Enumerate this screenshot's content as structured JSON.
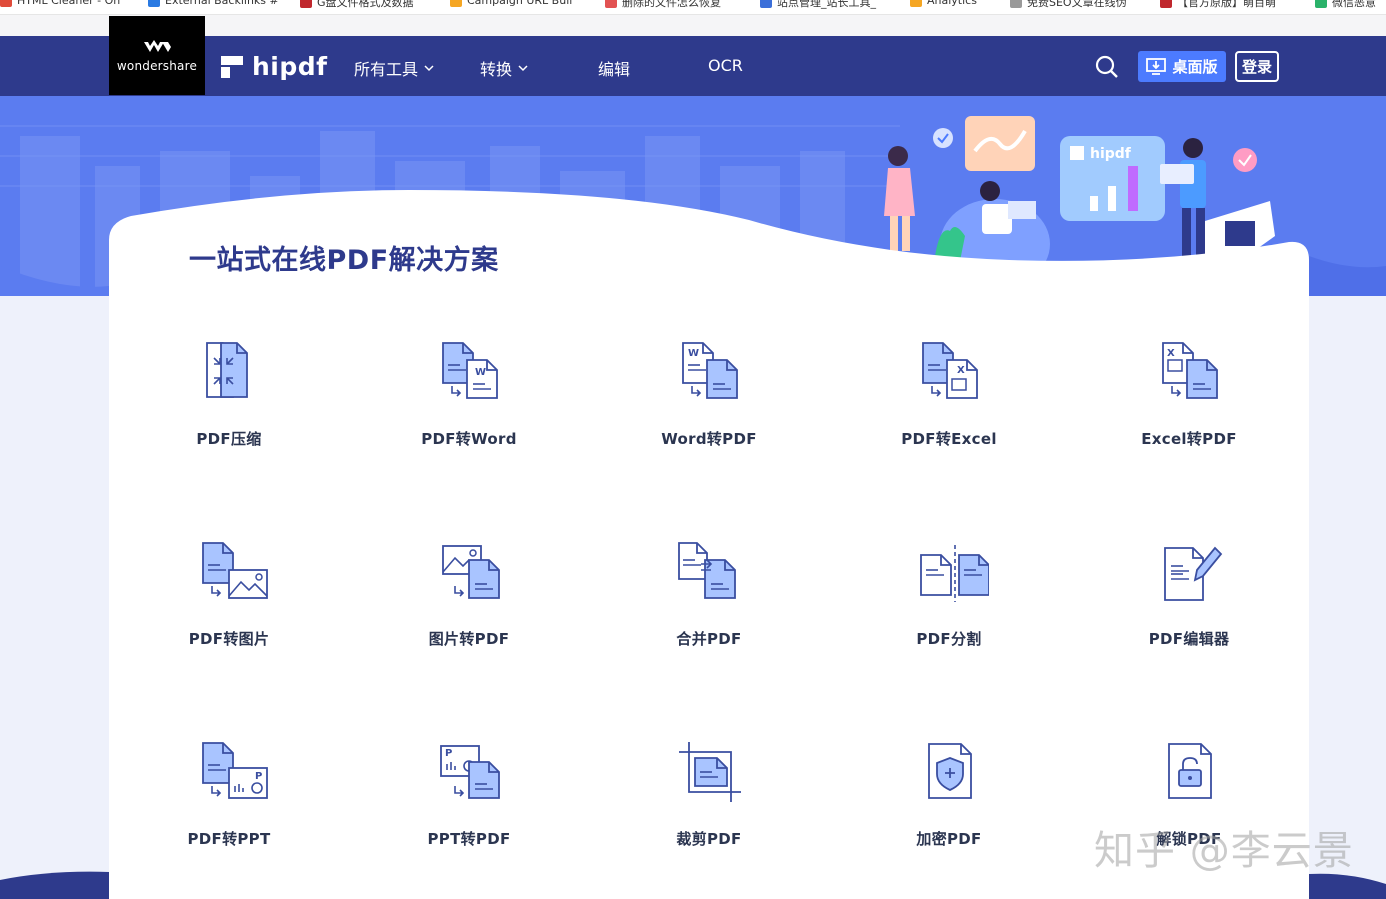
{
  "bookmarks": [
    {
      "label": "HTML Cleaner - On",
      "color": "#e04b3a"
    },
    {
      "label": "External Backlinks #",
      "color": "#2a7ae2"
    },
    {
      "label": "G盘文件格式及数据",
      "color": "#c0272d"
    },
    {
      "label": "Campaign URL Buil",
      "color": "#f5a623"
    },
    {
      "label": "删除的文件怎么恢复",
      "color": "#e25252"
    },
    {
      "label": "站点管理_站长工具_",
      "color": "#3b6fd9"
    },
    {
      "label": "Analytics",
      "color": "#f5a623"
    },
    {
      "label": "免费SEO文章在线伪",
      "color": "#999999"
    },
    {
      "label": "【官方原版】萌百萌",
      "color": "#c0272d"
    },
    {
      "label": "微信恶意",
      "color": "#2ab26a"
    }
  ],
  "brand": {
    "company": "wondershare",
    "product": "hipdf"
  },
  "nav": {
    "all_tools": "所有工具",
    "convert": "转换",
    "edit": "编辑",
    "ocr": "OCR",
    "desktop": "桌面版",
    "login": "登录"
  },
  "hero_badge": "hipdf",
  "main": {
    "title": "一站式在线PDF解决方案",
    "tools": [
      {
        "label": "PDF压缩",
        "icon": "compress-icon"
      },
      {
        "label": "PDF转Word",
        "icon": "pdf-to-word-icon"
      },
      {
        "label": "Word转PDF",
        "icon": "word-to-pdf-icon"
      },
      {
        "label": "PDF转Excel",
        "icon": "pdf-to-excel-icon"
      },
      {
        "label": "Excel转PDF",
        "icon": "excel-to-pdf-icon"
      },
      {
        "label": "PDF转图片",
        "icon": "pdf-to-image-icon"
      },
      {
        "label": "图片转PDF",
        "icon": "image-to-pdf-icon"
      },
      {
        "label": "合并PDF",
        "icon": "merge-icon"
      },
      {
        "label": "PDF分割",
        "icon": "split-icon"
      },
      {
        "label": "PDF编辑器",
        "icon": "editor-icon"
      },
      {
        "label": "PDF转PPT",
        "icon": "pdf-to-ppt-icon"
      },
      {
        "label": "PPT转PDF",
        "icon": "ppt-to-pdf-icon"
      },
      {
        "label": "裁剪PDF",
        "icon": "crop-icon"
      },
      {
        "label": "加密PDF",
        "icon": "encrypt-icon"
      },
      {
        "label": "解锁PDF",
        "icon": "unlock-icon"
      }
    ]
  },
  "watermark": "知乎 @李云景",
  "colors": {
    "nav": "#2e3a8c",
    "accent": "#4c7bff",
    "hero": "#5b7cf0",
    "icon_fill": "#a9c4ff",
    "icon_stroke": "#3a4ea0"
  }
}
